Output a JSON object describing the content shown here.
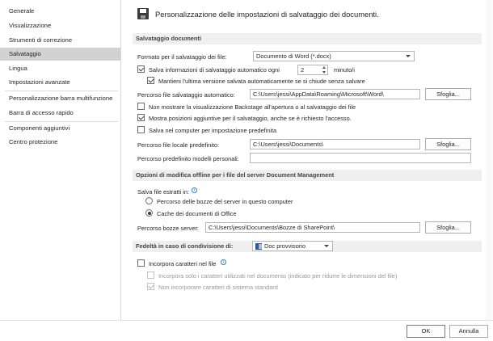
{
  "sidebar": {
    "items": [
      {
        "label": "Generale"
      },
      {
        "label": "Visualizzazione"
      },
      {
        "label": "Strumenti di correzione"
      },
      {
        "label": "Salvataggio"
      },
      {
        "label": "Lingua"
      },
      {
        "label": "Impostazioni avanzate"
      },
      {
        "label": "Personalizzazione barra multifunzione"
      },
      {
        "label": "Barra di accesso rapido"
      },
      {
        "label": "Componenti aggiuntivi"
      },
      {
        "label": "Centro protezione"
      }
    ],
    "selected": "Salvataggio"
  },
  "header": {
    "icon": "save-icon",
    "title": "Personalizzazione delle impostazioni di salvataggio dei documenti."
  },
  "save_documents": {
    "section_title": "Salvataggio documenti",
    "format_label": "Formato per il salvataggio dei file:",
    "format_value": "Documento di Word (*.docx)",
    "autosave_label": "Salva informazioni di salvataggio automatico ogni",
    "autosave_checked": true,
    "autosave_minutes": "2",
    "autosave_unit": "minuto/i",
    "keep_last_label": "Mantieni l'ultima versione salvata automaticamente se si chiude senza salvare",
    "keep_last_checked": true,
    "autorecover_label": "Percorso file salvataggio automatico:",
    "autorecover_path": "C:\\Users\\jessi\\AppData\\Roaming\\Microsoft\\Word\\",
    "browse_label": "Sfoglia...",
    "backstage_label": "Non mostrare la visualizzazione Backstage all'apertura o al salvataggio dei file",
    "backstage_checked": false,
    "show_locations_label": "Mostra posizioni aggiuntive per il salvataggio, anche se è richiesto l'accesso.",
    "show_locations_checked": true,
    "save_computer_label": "Salva nel computer per impostazione predefinita",
    "save_computer_checked": false,
    "local_path_label": "Percorso file locale predefinito:",
    "local_path_value": "C:\\Users\\jessi\\Documents\\",
    "templates_label": "Percorso predefinito modelli personali:",
    "templates_value": ""
  },
  "offline_editing": {
    "section_title": "Opzioni di modifica offline per i file del server Document Management",
    "save_in_label": "Salva file estratti in:",
    "radio_server_label": "Percorso delle bozze del server in questo computer",
    "radio_server_checked": false,
    "radio_cache_label": "Cache dei documenti di Office",
    "radio_cache_checked": true,
    "drafts_label": "Percorso bozze server:",
    "drafts_value": "C:\\Users\\jessi\\Documents\\Bozze di SharePoint\\",
    "browse_label": "Sfoglia..."
  },
  "fidelity": {
    "section_title": "Fedeltà in caso di condivisione di:",
    "doc_value": "Doc provvisorio",
    "embed_fonts_label": "Incorpora caratteri nel file",
    "embed_fonts_checked": false,
    "embed_used_label": "Incorpora solo i caratteri utilizzati nel documento (indicato per ridurre le dimensioni del file)",
    "embed_used_checked": false,
    "no_system_fonts_label": "Non incorporare caratteri di sistema standard",
    "no_system_fonts_checked": true
  },
  "footer": {
    "ok_label": "OK",
    "cancel_label": "Annulla"
  }
}
